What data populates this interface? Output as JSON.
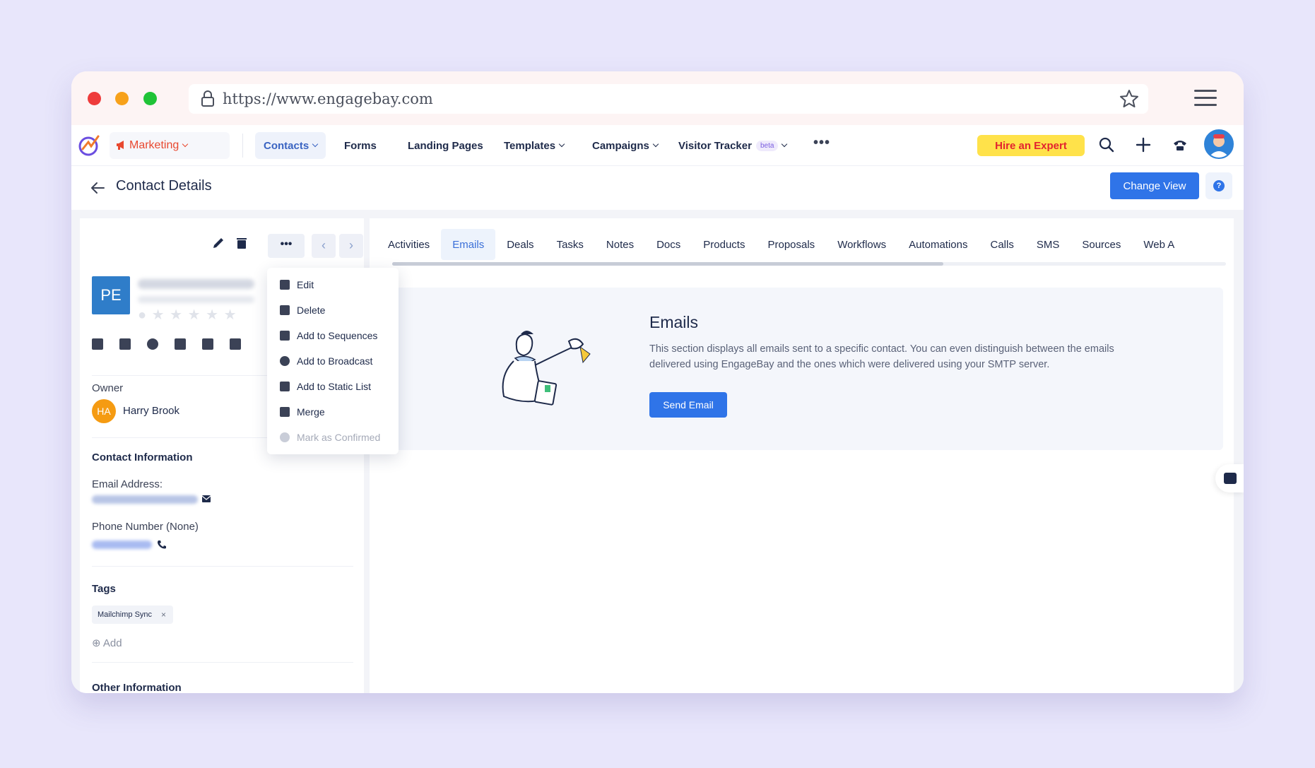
{
  "browser": {
    "url": "https://www.engagebay.com"
  },
  "nav": {
    "module": "Marketing",
    "items": [
      {
        "label": "Contacts",
        "has_dropdown": true,
        "active": true
      },
      {
        "label": "Forms",
        "has_dropdown": false,
        "active": false
      },
      {
        "label": "Landing Pages",
        "has_dropdown": false,
        "active": false
      },
      {
        "label": "Templates",
        "has_dropdown": true,
        "active": false
      },
      {
        "label": "Campaigns",
        "has_dropdown": true,
        "active": false
      },
      {
        "label": "Visitor Tracker",
        "has_dropdown": true,
        "active": false
      }
    ],
    "beta_badge": "beta",
    "more": "•••",
    "hire_expert": "Hire an Expert"
  },
  "page": {
    "title": "Contact Details",
    "change_view": "Change View",
    "help": "?"
  },
  "contact": {
    "initials": "PE",
    "owner_label": "Owner",
    "owner_initials": "HA",
    "owner_name": "Harry Brook",
    "contact_info_title": "Contact Information",
    "email_label": "Email Address:",
    "phone_label": "Phone Number (None)",
    "tags_title": "Tags",
    "tags": [
      "Mailchimp Sync"
    ],
    "tag_remove": "×",
    "add_tag": "Add",
    "other_info_title": "Other Information"
  },
  "more_menu": {
    "items": [
      {
        "label": "Edit",
        "enabled": true
      },
      {
        "label": "Delete",
        "enabled": true
      },
      {
        "label": "Add to Sequences",
        "enabled": true
      },
      {
        "label": "Add to Broadcast",
        "enabled": true
      },
      {
        "label": "Add to Static List",
        "enabled": true
      },
      {
        "label": "Merge",
        "enabled": true
      },
      {
        "label": "Mark as Confirmed",
        "enabled": false
      }
    ]
  },
  "tabs": [
    "Activities",
    "Emails",
    "Deals",
    "Tasks",
    "Notes",
    "Docs",
    "Products",
    "Proposals",
    "Workflows",
    "Automations",
    "Calls",
    "SMS",
    "Sources",
    "Web A"
  ],
  "active_tab": "Emails",
  "emails_section": {
    "title": "Emails",
    "description": "This section displays all emails sent to a specific contact. You can even distinguish between the emails delivered using EngageBay and the ones which were delivered using your SMTP server.",
    "button": "Send Email"
  },
  "colors": {
    "primary": "#2f74e8",
    "marketing": "#e8482f",
    "hire_bg": "#ffe24a",
    "hire_text": "#e3232f",
    "contact_avatar": "#2f7dc9",
    "owner_avatar": "#f59b12"
  }
}
